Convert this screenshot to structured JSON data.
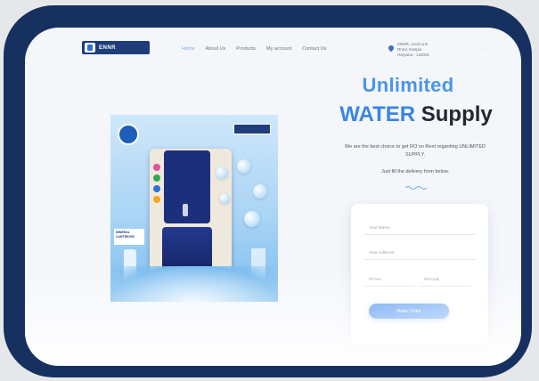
{
  "brand": {
    "logo_text": "ENNR"
  },
  "nav": {
    "items": [
      {
        "label": "Home",
        "active": true
      },
      {
        "label": "About Us",
        "active": false
      },
      {
        "label": "Products",
        "active": false
      },
      {
        "label": "My account",
        "active": false
      },
      {
        "label": "Contact Us",
        "active": false
      }
    ]
  },
  "address": {
    "line1": "SNNR, Annd unn",
    "line2": "Rnnd, Kanpur",
    "line3": "Haryana - 132001"
  },
  "hero": {
    "title_line1": "Unlimited",
    "title_line2_a": "WATER",
    "title_line2_b": "Supply",
    "description": "We are the best choice to get RO on Rent regarding UNLIMITED SUPPLY.",
    "note": "Just fill the delivery form below."
  },
  "product_image": {
    "badge_text": "MINERAL CARTRIDGE"
  },
  "form": {
    "name_placeholder": "Your Name",
    "address_placeholder": "Your Address",
    "phone_placeholder": "Phone",
    "pincode_placeholder": "Pincode",
    "submit_label": "Make Order"
  },
  "colors": {
    "frame": "#16305f",
    "accent": "#3a86e0",
    "button": "#4b8ef0"
  },
  "icons": [
    "location-pin-icon",
    "wave-divider-icon",
    "brand-logo-icon"
  ]
}
